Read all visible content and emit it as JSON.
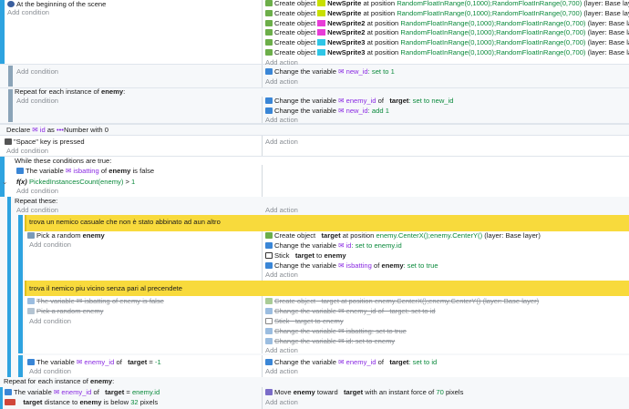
{
  "add_condition": "Add condition",
  "add_action": "Add action",
  "e1": {
    "condition": "At the beginning of the scene",
    "actions": [
      {
        "create": "Create object",
        "name": "NewSprite",
        "at": "at position",
        "expr": "RandomFloatInRange(0,1000);RandomFloatInRange(0,700)",
        "layer": "(layer: Base layer)",
        "color": "#c8e000"
      },
      {
        "create": "Create object",
        "name": "NewSprite",
        "at": "at position",
        "expr": "RandomFloatInRange(0,1000);RandomFloatInRange(0,700)",
        "layer": "(layer: Base layer)",
        "color": "#c8e000"
      },
      {
        "create": "Create object",
        "name": "NewSprite2",
        "at": "at position",
        "expr": "RandomFloatInRange(0,1000);RandomFloatInRange(0,700)",
        "layer": "(layer: Base layer)",
        "color": "#e83cd8"
      },
      {
        "create": "Create object",
        "name": "NewSprite2",
        "at": "at position",
        "expr": "RandomFloatInRange(0,1000);RandomFloatInRange(0,700)",
        "layer": "(layer: Base layer)",
        "color": "#e83cd8"
      },
      {
        "create": "Create object",
        "name": "NewSprite3",
        "at": "at position",
        "expr": "RandomFloatInRange(0,1000);RandomFloatInRange(0,700)",
        "layer": "(layer: Base layer)",
        "color": "#2fc6e6"
      },
      {
        "create": "Create object",
        "name": "NewSprite3",
        "at": "at position",
        "expr": "RandomFloatInRange(0,1000);RandomFloatInRange(0,700)",
        "layer": "(layer: Base layer)",
        "color": "#2fc6e6"
      }
    ]
  },
  "e2": {
    "a1": "Change the variable",
    "a2": "new_id",
    "a3": ": set to",
    "a4": "1"
  },
  "e3": {
    "repeat": "Repeat for each instance of",
    "obj": "enemy",
    "r1": [
      "Change the variable",
      "enemy_id",
      "of",
      "target",
      ": set to",
      "new_id"
    ],
    "r2": [
      "Change the variable",
      "new_id",
      ": add",
      "1"
    ]
  },
  "e4": {
    "declare": "Declare",
    "id": "id",
    "as": "as",
    "num": "Number with 0"
  },
  "e5": {
    "key": "\"Space\" key is pressed"
  },
  "e6": {
    "while": "While these conditions are true:",
    "c1": [
      "The variable",
      "isbatting",
      "of",
      "enemy",
      "is",
      "false"
    ],
    "c2": "PickedInstancesCount(enemy)",
    "c3": ">",
    "c4": "1",
    "repeat": "Repeat these:"
  },
  "comment1": "trova un nemico casuale che non è stato abbinato ad aun altro",
  "e7": {
    "cond": [
      "Pick a random",
      "enemy"
    ],
    "x1": [
      "Create object",
      "target",
      "at position",
      "enemy.CenterX();enemy.CenterY()",
      "(layer: Base layer)"
    ],
    "x2": [
      "Change the variable",
      "id",
      ": set to",
      "enemy.id"
    ],
    "x3": [
      "Stick",
      "target",
      "to",
      "enemy"
    ],
    "x4": [
      "Change the variable",
      "isbatting",
      "of",
      "enemy",
      ": set to",
      "true"
    ]
  },
  "comment2": "trova il nemico piu vicino senza pari al precendete",
  "e8": {
    "c1": [
      "The variable",
      "isbatting",
      "of",
      "enemy",
      "is",
      "false"
    ],
    "c2": [
      "Pick a random",
      "enemy"
    ],
    "x1": [
      "Create object",
      "target",
      "at position",
      "enemy.CenterX();enemy.CenterY()",
      "(layer: Base layer)"
    ],
    "x2": [
      "Change the variable",
      "enemy_id",
      "of",
      "target",
      ": set to",
      "id"
    ],
    "x3": [
      "Stick",
      "target",
      "to",
      "enemy"
    ],
    "x4": [
      "Change the variable",
      "isbatting",
      ": set to",
      "true"
    ],
    "x5": [
      "Change the variable",
      "id",
      ": set to",
      "enemy"
    ]
  },
  "e9": {
    "c": [
      "The variable",
      "enemy_id",
      "of",
      "target",
      "=",
      "-1"
    ],
    "x": [
      "Change the variable",
      "enemy_id",
      "of",
      "target",
      ": set to",
      "id"
    ]
  },
  "e10": {
    "repeat": "Repeat for each instance of",
    "obj": "enemy",
    "c1": [
      "The variable",
      "enemy_id",
      "of",
      "target",
      "=",
      "enemy.id"
    ],
    "c2": [
      "target",
      "distance to",
      "enemy",
      "is below",
      "32",
      "pixels"
    ],
    "x": [
      "Move",
      "enemy",
      "toward",
      "target",
      "with an instant force of",
      "70",
      "pixels"
    ]
  }
}
